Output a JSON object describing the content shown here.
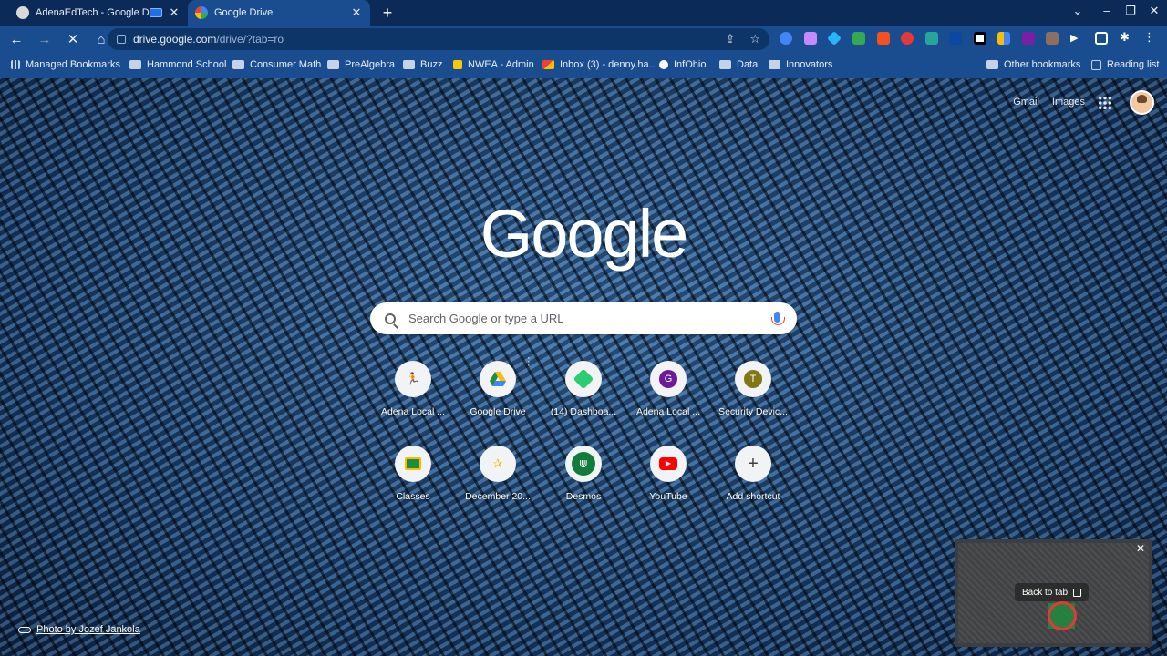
{
  "browser": {
    "tabs": [
      {
        "title": "AdenaEdTech - Google Drive",
        "active": false
      },
      {
        "title": "Google Drive",
        "active": true
      }
    ],
    "address": {
      "host": "drive.google.com",
      "path": "/drive/?tab=ro"
    },
    "bookmarks": [
      {
        "label": "Managed Bookmarks",
        "icon": "grid-icon"
      },
      {
        "label": "Hammond School",
        "icon": "folder-icon"
      },
      {
        "label": "Consumer Math",
        "icon": "folder-icon"
      },
      {
        "label": "PreAlgebra",
        "icon": "folder-icon"
      },
      {
        "label": "Buzz",
        "icon": "folder-icon"
      },
      {
        "label": "NWEA - Admin",
        "icon": "nwea-icon"
      },
      {
        "label": "Inbox (3) - denny.ha...",
        "icon": "gmail-icon"
      },
      {
        "label": "InfOhio",
        "icon": "power-icon"
      },
      {
        "label": "Data",
        "icon": "folder-icon"
      },
      {
        "label": "Innovators",
        "icon": "folder-icon"
      },
      {
        "label": "Other bookmarks",
        "icon": "folder-icon"
      },
      {
        "label": "Reading list",
        "icon": "reading-list-icon"
      }
    ]
  },
  "newtab": {
    "links": {
      "gmail": "Gmail",
      "images": "Images"
    },
    "logo": "Google",
    "search_placeholder": "Search Google or type a URL",
    "shortcuts": [
      {
        "label": "Adena Local ...",
        "icon": "runner-icon"
      },
      {
        "label": "Google Drive",
        "icon": "drive-icon"
      },
      {
        "label": "(14) Dashboa...",
        "icon": "dashboard-icon"
      },
      {
        "label": "Adena Local ...",
        "icon": "g-letter-icon",
        "letter": "G"
      },
      {
        "label": "Security Devic...",
        "icon": "t-letter-icon",
        "letter": "T"
      },
      {
        "label": "Classes",
        "icon": "classroom-icon"
      },
      {
        "label": "December 20...",
        "icon": "star-icon"
      },
      {
        "label": "Desmos",
        "icon": "desmos-icon"
      },
      {
        "label": "YouTube",
        "icon": "youtube-icon"
      },
      {
        "label": "Add shortcut",
        "icon": "plus-icon",
        "glyph": "+"
      }
    ],
    "photo_credit": "Photo by Jozef Jankola"
  },
  "pip": {
    "back_label": "Back to tab"
  },
  "colors": {
    "chrome_bg": "#1a4d8f",
    "tabstrip_bg": "#0b2a57"
  }
}
